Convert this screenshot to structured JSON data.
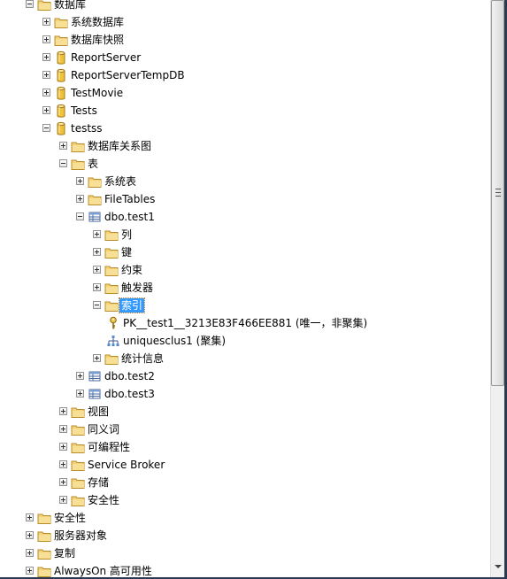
{
  "tree": {
    "items": [
      {
        "label": "数据库",
        "level": 0,
        "expander": "minus",
        "icon": "folder-icon"
      },
      {
        "label": "系统数据库",
        "level": 1,
        "expander": "plus",
        "icon": "folder-icon"
      },
      {
        "label": "数据库快照",
        "level": 1,
        "expander": "plus",
        "icon": "folder-icon"
      },
      {
        "label": "ReportServer",
        "level": 1,
        "expander": "plus",
        "icon": "database-icon"
      },
      {
        "label": "ReportServerTempDB",
        "level": 1,
        "expander": "plus",
        "icon": "database-icon"
      },
      {
        "label": "TestMovie",
        "level": 1,
        "expander": "plus",
        "icon": "database-icon"
      },
      {
        "label": "Tests",
        "level": 1,
        "expander": "plus",
        "icon": "database-icon"
      },
      {
        "label": "testss",
        "level": 1,
        "expander": "minus",
        "icon": "database-icon"
      },
      {
        "label": "数据库关系图",
        "level": 2,
        "expander": "plus",
        "icon": "folder-icon"
      },
      {
        "label": "表",
        "level": 2,
        "expander": "minus",
        "icon": "folder-icon"
      },
      {
        "label": "系统表",
        "level": 3,
        "expander": "plus",
        "icon": "folder-icon"
      },
      {
        "label": "FileTables",
        "level": 3,
        "expander": "plus",
        "icon": "folder-icon"
      },
      {
        "label": "dbo.test1",
        "level": 3,
        "expander": "minus",
        "icon": "table-icon"
      },
      {
        "label": "列",
        "level": 4,
        "expander": "plus",
        "icon": "folder-icon"
      },
      {
        "label": "键",
        "level": 4,
        "expander": "plus",
        "icon": "folder-icon"
      },
      {
        "label": "约束",
        "level": 4,
        "expander": "plus",
        "icon": "folder-icon"
      },
      {
        "label": "触发器",
        "level": 4,
        "expander": "plus",
        "icon": "folder-icon"
      },
      {
        "label": "索引",
        "level": 4,
        "expander": "minus",
        "icon": "folder-icon",
        "selected": true
      },
      {
        "label": "PK__test1__3213E83F466EE881 (唯一，非聚集)",
        "level": 5,
        "expander": "none",
        "icon": "key-icon"
      },
      {
        "label": "uniquesclus1 (聚集)",
        "level": 5,
        "expander": "none",
        "icon": "clustered-index-icon"
      },
      {
        "label": "统计信息",
        "level": 4,
        "expander": "plus",
        "icon": "folder-icon"
      },
      {
        "label": "dbo.test2",
        "level": 3,
        "expander": "plus",
        "icon": "table-icon"
      },
      {
        "label": "dbo.test3",
        "level": 3,
        "expander": "plus",
        "icon": "table-icon"
      },
      {
        "label": "视图",
        "level": 2,
        "expander": "plus",
        "icon": "folder-icon"
      },
      {
        "label": "同义词",
        "level": 2,
        "expander": "plus",
        "icon": "folder-icon"
      },
      {
        "label": "可编程性",
        "level": 2,
        "expander": "plus",
        "icon": "folder-icon"
      },
      {
        "label": "Service Broker",
        "level": 2,
        "expander": "plus",
        "icon": "folder-icon"
      },
      {
        "label": "存储",
        "level": 2,
        "expander": "plus",
        "icon": "folder-icon"
      },
      {
        "label": "安全性",
        "level": 2,
        "expander": "plus",
        "icon": "folder-icon"
      },
      {
        "label": "安全性",
        "level": 0,
        "expander": "plus",
        "icon": "folder-icon"
      },
      {
        "label": "服务器对象",
        "level": 0,
        "expander": "plus",
        "icon": "folder-icon"
      },
      {
        "label": "复制",
        "level": 0,
        "expander": "plus",
        "icon": "folder-icon"
      },
      {
        "label": "AlwaysOn 高可用性",
        "level": 0,
        "expander": "plus",
        "icon": "folder-icon"
      }
    ]
  },
  "colors": {
    "selection": "#3399ff",
    "folder": "#f0c850",
    "database": "#e8b830",
    "window_border": "#2b3a52"
  }
}
